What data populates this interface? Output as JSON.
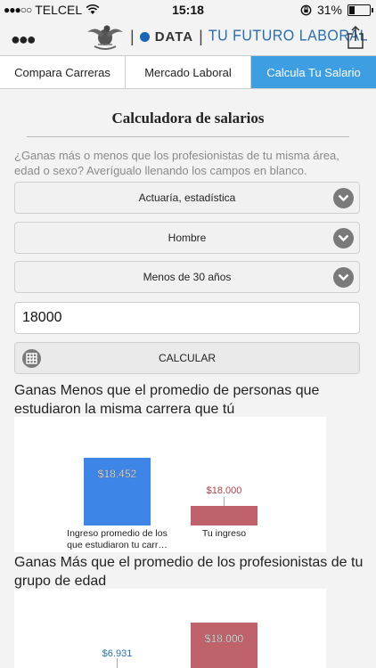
{
  "status": {
    "carrier": "TELCEL",
    "time": "15:18",
    "battery": "31%",
    "battery_level": 0.31
  },
  "nav": {
    "brand_data": "DATA",
    "brand_tagline": "TU FUTURO LABORAL",
    "more_icon": "more-dots-icon",
    "share_icon": "share-icon"
  },
  "tabs": [
    {
      "label": "Compara Carreras",
      "active": false
    },
    {
      "label": "Mercado Laboral",
      "active": false
    },
    {
      "label": "Calcula Tu Salario",
      "active": true
    }
  ],
  "calculator": {
    "title": "Calculadora de salarios",
    "description": "¿Ganas más o menos que los profesionistas de tu misma área, edad o sexo? Averígualo llenando los campos en blanco.",
    "career_select": "Actuaría, estadística",
    "sex_select": "Hombre",
    "age_select": "Menos de 30 años",
    "income_value": "18000",
    "calculate_label": "CALCULAR"
  },
  "results": {
    "heading_career": "Ganas Menos que el promedio de personas que estudiaron la misma carrera que tú",
    "heading_age": "Ganas Más que el promedio de los profesionistas de tu grupo de edad"
  },
  "colors": {
    "accent": "#3d9ee2",
    "bar_average": "#3d86e8",
    "bar_user": "#c0626b",
    "label_average": "#2a6db0",
    "label_user": "#a8434d"
  },
  "chart_data": [
    {
      "type": "bar",
      "categories": [
        "Ingreso promedio de los que estudiaron tu carr…",
        "Tu ingreso"
      ],
      "values": [
        18452,
        18000
      ],
      "labels": [
        "$18.452",
        "$18.000"
      ]
    },
    {
      "type": "bar",
      "categories": [
        "",
        ""
      ],
      "values": [
        6931,
        18000
      ],
      "labels": [
        "$6.931",
        "$18.000"
      ]
    }
  ]
}
